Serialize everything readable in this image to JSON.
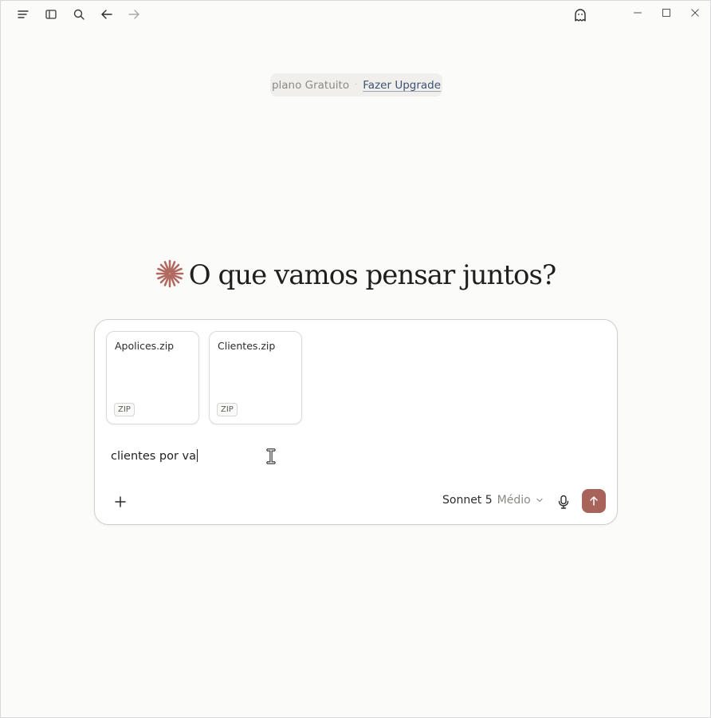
{
  "titlebar": {
    "icons": [
      "menu-icon",
      "sidebar-icon",
      "search-icon",
      "back-arrow-icon",
      "forward-arrow-icon",
      "ghost-icon"
    ],
    "window_controls": [
      "minimize-icon",
      "maximize-icon",
      "close-icon"
    ]
  },
  "plan": {
    "text": "plano Gratuito",
    "separator": "·",
    "upgrade_link": "Fazer Upgrade"
  },
  "hero": {
    "icon": "sparkle-icon",
    "title": "O que vamos pensar juntos?"
  },
  "composer": {
    "attachments": [
      {
        "name": "Apolices.zip",
        "type": "ZIP"
      },
      {
        "name": "Clientes.zip",
        "type": "ZIP"
      }
    ],
    "input_value": "clientes por va",
    "model_name": "Sonnet 5",
    "model_level": "Médio"
  },
  "colors": {
    "accent": "#a8635a",
    "link": "#3d5275",
    "background": "#fbfbfa"
  }
}
